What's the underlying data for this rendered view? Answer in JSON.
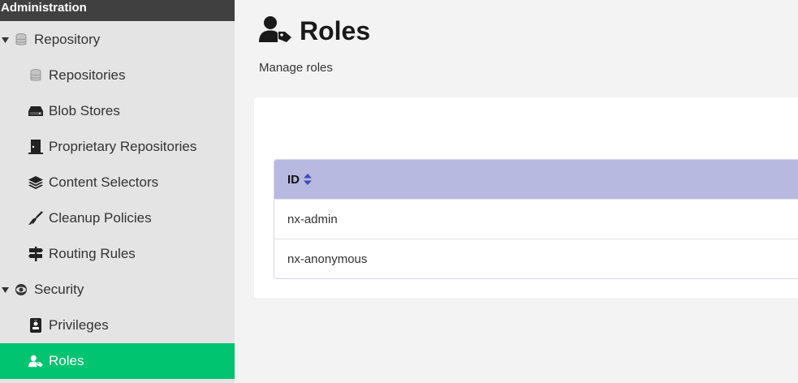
{
  "sidebar": {
    "header": "Administration",
    "items": [
      {
        "label": "Repository",
        "icon": "database-icon"
      },
      {
        "label": "Repositories",
        "icon": "database-icon"
      },
      {
        "label": "Blob Stores",
        "icon": "hard-drive-icon"
      },
      {
        "label": "Proprietary Repositories",
        "icon": "door-icon"
      },
      {
        "label": "Content Selectors",
        "icon": "layers-icon"
      },
      {
        "label": "Cleanup Policies",
        "icon": "broom-icon"
      },
      {
        "label": "Routing Rules",
        "icon": "signpost-icon"
      },
      {
        "label": "Security",
        "icon": "eye-icon"
      },
      {
        "label": "Privileges",
        "icon": "id-badge-icon"
      },
      {
        "label": "Roles",
        "icon": "user-tag-icon"
      }
    ]
  },
  "main": {
    "title": "Roles",
    "subtitle": "Manage roles",
    "table": {
      "column_header": "ID",
      "rows": [
        "nx-admin",
        "nx-anonymous"
      ]
    }
  },
  "colors": {
    "active": "#00c46f",
    "table_header": "#b7b9e0",
    "sidebar_header": "#404040"
  }
}
